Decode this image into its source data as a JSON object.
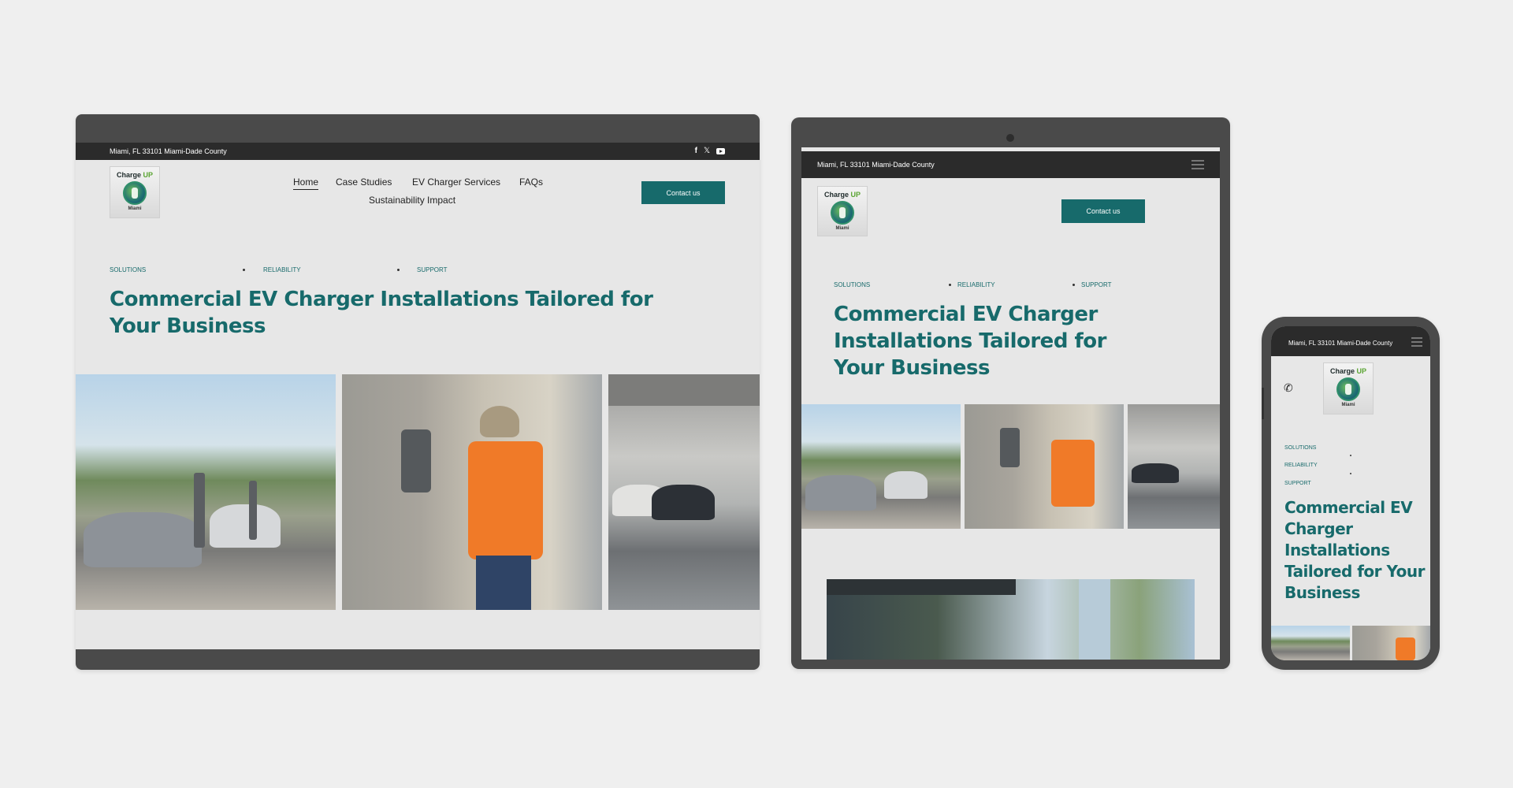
{
  "brand": {
    "name_part1": "Charge ",
    "name_part2": "UP",
    "city": "Miami"
  },
  "topbar": {
    "address": "Miami, FL 33101 Miami-Dade County"
  },
  "nav": {
    "home": "Home",
    "case_studies": "Case Studies",
    "services": "EV Charger Services",
    "faqs": "FAQs",
    "impact": "Sustainability Impact"
  },
  "contact_button": "Contact us",
  "tags": [
    "SOLUTIONS",
    "RELIABILITY",
    "SUPPORT"
  ],
  "hero": {
    "title": "Commercial EV Charger Installations Tailored for Your Business"
  },
  "icons": {
    "facebook": "facebook-icon",
    "x": "x-icon",
    "youtube": "youtube-icon",
    "phone": "phone-icon",
    "menu": "hamburger-menu-icon"
  },
  "colors": {
    "accent": "#176a6b",
    "topbar": "#2b2b2b",
    "page_bg": "#e7e7e7",
    "device_frame": "#4a4a4a"
  }
}
